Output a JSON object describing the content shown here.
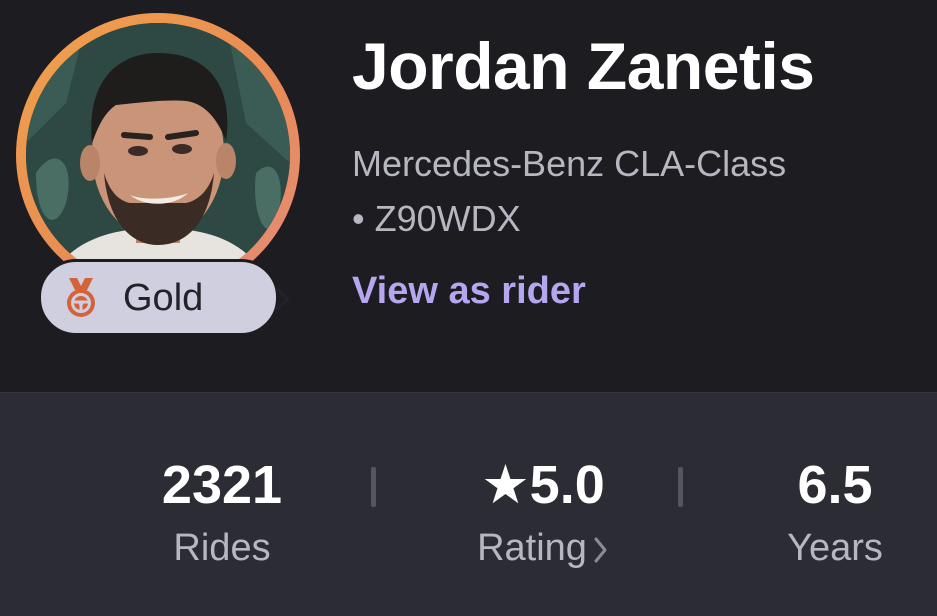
{
  "profile": {
    "name": "Jordan Zanetis",
    "vehicle_model": "Mercedes-Benz CLA-Class",
    "plate": "• Z90WDX",
    "view_link": "View as rider"
  },
  "badge": {
    "label": "Gold",
    "icon": "medal-steering-wheel-icon",
    "chevron": "chevron-right-icon"
  },
  "stats": [
    {
      "value": "2321",
      "label": "Rides"
    },
    {
      "value": "★5.0",
      "label": "Rating"
    },
    {
      "value": "6.5",
      "label": "Years"
    }
  ],
  "colors": {
    "background": "#1c1c21",
    "stats_panel": "#2c2c34",
    "accent_link": "#b6a5ef",
    "badge_bg": "#cfcfe0",
    "ring": "#f0a24a"
  }
}
